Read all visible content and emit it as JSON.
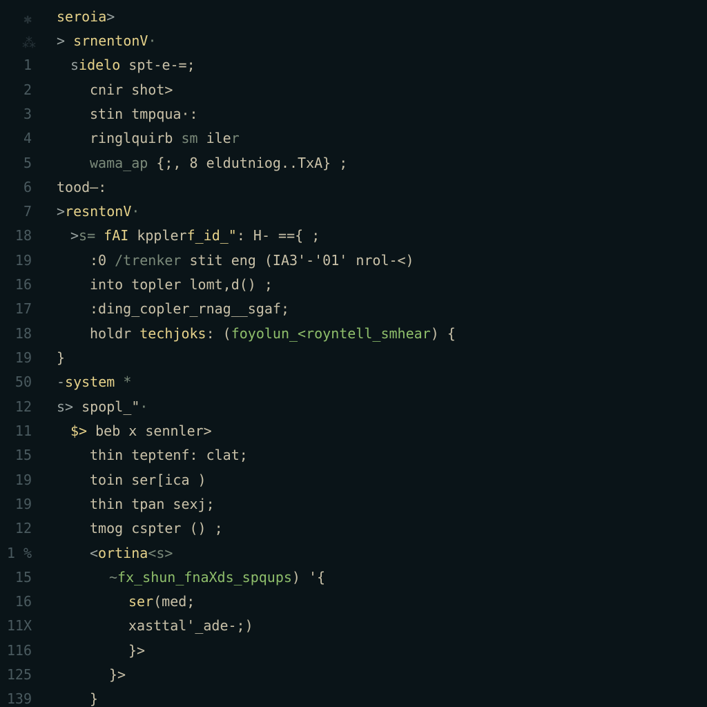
{
  "gutter": {
    "icon0": "✱",
    "icon1": "⁂",
    "lines": [
      "1",
      "2",
      "3",
      "4",
      "5",
      "6",
      "7",
      "18",
      "19",
      "16",
      "17",
      "18",
      "19",
      "50",
      "12",
      "11",
      "15",
      "19",
      "19",
      "12",
      "1 %",
      "15",
      "16",
      "11X",
      "116",
      "125",
      "139"
    ]
  },
  "code": {
    "l_header": {
      "a": "seroia",
      "b": ">"
    },
    "l_sub": {
      "a": ">",
      "b": "srnentonV",
      "c": "·"
    },
    "l1": {
      "a": "s",
      "b": "idelo",
      "c": " spt-e-=;"
    },
    "l2": "cnir shot>",
    "l3": "stin tmpqua·:",
    "l4": {
      "a": "ringlquirb ",
      "b": "sm",
      "c": " ile",
      "d": "r"
    },
    "l5": {
      "a": "wama_ap ",
      "b": "{;, ",
      "c": "8",
      "d": " eldutniog..TxA} ;"
    },
    "l6": "tood—:",
    "l7": {
      "a": ">",
      "b": "resntonV",
      "c": "·"
    },
    "l8": {
      "a": ">",
      "b": "s= ",
      "c": "fAI",
      "d": " kppler",
      "e": "f_id_\"",
      "f": ": H- =={ ;"
    },
    "l9": {
      "a": ":0 ",
      "b": "/trenker",
      "c": " stit eng (IA3'-'01' nrol-<)"
    },
    "l10": "into topler lomt,d() ;",
    "l11": ":ding_copler_rnag__sgaf;",
    "l12": {
      "a": "holdr ",
      "b": "techjoks",
      "c": ": (",
      "d": "foyolun_<royntell_smhear",
      "e": ") {"
    },
    "l13": "}",
    "l14": {
      "a": "-",
      "b": "system",
      "c": " *"
    },
    "l15": {
      "a": "s>",
      "b": " spopl_\"",
      "c": "·"
    },
    "l16": {
      "a": "$>",
      "b": " beb x sennler>"
    },
    "l17": "thin teptenf: clat;",
    "l18": "toin ser[ica )",
    "l19": "thin tpan sexj;",
    "l20": "tmog cspter () ;",
    "l21": {
      "a": "<",
      "b": "ortina",
      "c": "<s>"
    },
    "l22": {
      "a": "~",
      "b": "fx_shun_fnaXds_spqups",
      "c": ") '{"
    },
    "l23": {
      "a": "ser",
      "b": "(med;"
    },
    "l24": "xasttal'_ade-;)",
    "l25": "}>",
    "l26": "}>",
    "l27": "}"
  }
}
